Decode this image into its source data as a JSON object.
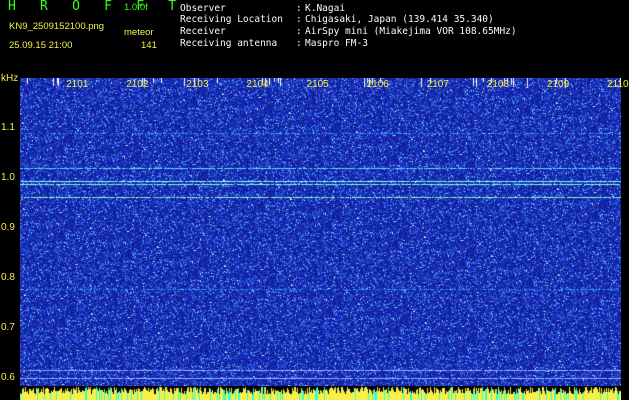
{
  "header": {
    "app_title": "H R O F F T",
    "version": "1.0.0f",
    "filename": "KN9_2509152100.png",
    "mode": "meteor",
    "datetime": "25.09.15 21:00",
    "count": "141"
  },
  "info": [
    {
      "label": "Observer",
      "colon": ":",
      "value": "K.Nagai"
    },
    {
      "label": "Receiving Location",
      "colon": ":",
      "value": "Chigasaki, Japan (139.414 35.340)"
    },
    {
      "label": "Receiver",
      "colon": ":",
      "value": "AirSpy mini (Miakejima VOR 108.65MHz)"
    },
    {
      "label": "Receiving antenna",
      "colon": ":",
      "value": "Maspro FM-3"
    }
  ],
  "chart_data": {
    "type": "heatmap",
    "ylabel": "kHz",
    "x_ticks": [
      "2101",
      "2102",
      "2103",
      "2104",
      "2105",
      "2106",
      "2107",
      "2108",
      "2109",
      "2110"
    ],
    "y_ticks": [
      "1.1",
      "1.0",
      "0.9",
      "0.8",
      "0.7",
      "0.6"
    ],
    "y_tick_values": [
      1.1,
      1.0,
      0.9,
      0.8,
      0.7,
      0.6
    ],
    "y_range_khz": [
      0.585,
      1.2
    ],
    "x_range_minutes": [
      2100,
      2110
    ],
    "horizontal_lines_khz": [
      {
        "f": 1.09,
        "color": "#2aa0ff",
        "strength": 0.5
      },
      {
        "f": 1.02,
        "color": "#5fd8ff",
        "strength": 0.85
      },
      {
        "f": 0.995,
        "color": "#7fffff",
        "strength": 0.95
      },
      {
        "f": 0.988,
        "color": "#7fffd0",
        "strength": 0.9
      },
      {
        "f": 0.963,
        "color": "#7fffd0",
        "strength": 0.85
      },
      {
        "f": 0.778,
        "color": "#2aa0ff",
        "strength": 0.45
      },
      {
        "f": 0.617,
        "color": "#9ab0ff",
        "strength": 0.9
      },
      {
        "f": 0.6,
        "color": "#9ab0ff",
        "strength": 0.9
      }
    ],
    "colors": {
      "background": "#1a2fa8",
      "noise_bright": "#6bd1ff",
      "bottom_bar": "#f6f04a",
      "bottom_bar_alt": "#33ffcc"
    }
  }
}
